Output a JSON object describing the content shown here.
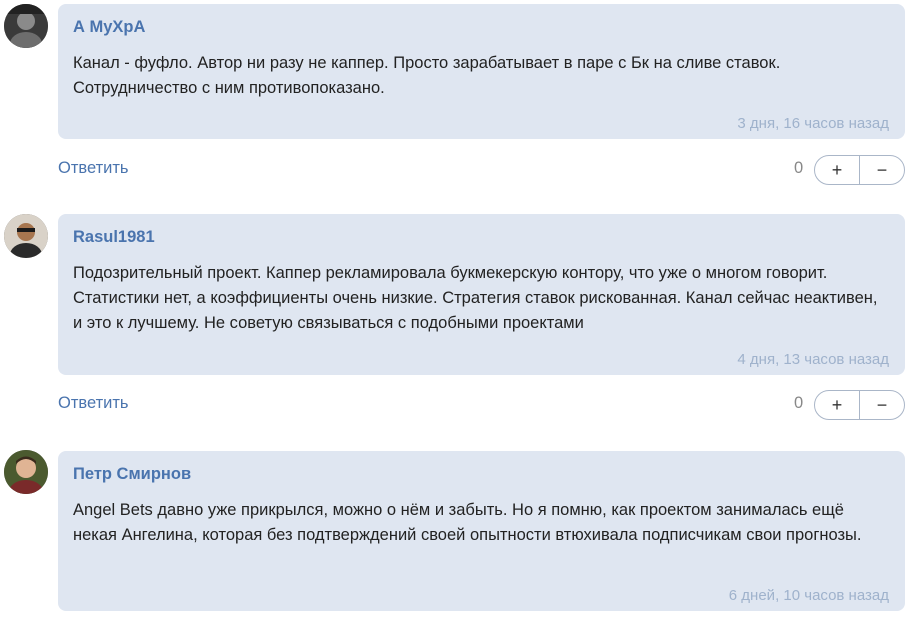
{
  "reply_label": "Ответить",
  "comments": [
    {
      "author": "А МуХрА",
      "text": "Канал - фуфло. Автор ни разу не каппер. Просто зарабатывает в паре с Бк на сливе ставок. Сотрудничество с ним противопоказано.",
      "time": "3 дня, 16 часов назад",
      "votes": "0",
      "plus": "+",
      "minus": "−"
    },
    {
      "author": "Rasul1981",
      "text": "Подозрительный проект. Каппер рекламировала букмекерскую контору, что уже о многом говорит. Статистики нет, а коэффициенты очень низкие. Стратегия ставок рискованная. Канал сейчас неактивен, и это к лучшему. Не советую связываться с подобными проектами",
      "time": "4 дня, 13 часов назад",
      "votes": "0",
      "plus": "+",
      "minus": "−"
    },
    {
      "author": "Петр Смирнов",
      "text": "Angel Bets давно уже прикрылся, можно о нём и забыть. Но я помню, как проектом занималась ещё некая Ангелина, которая без подтверждений своей опытности втюхивала подписчикам свои прогнозы.",
      "time": "6 дней, 10 часов назад"
    }
  ]
}
